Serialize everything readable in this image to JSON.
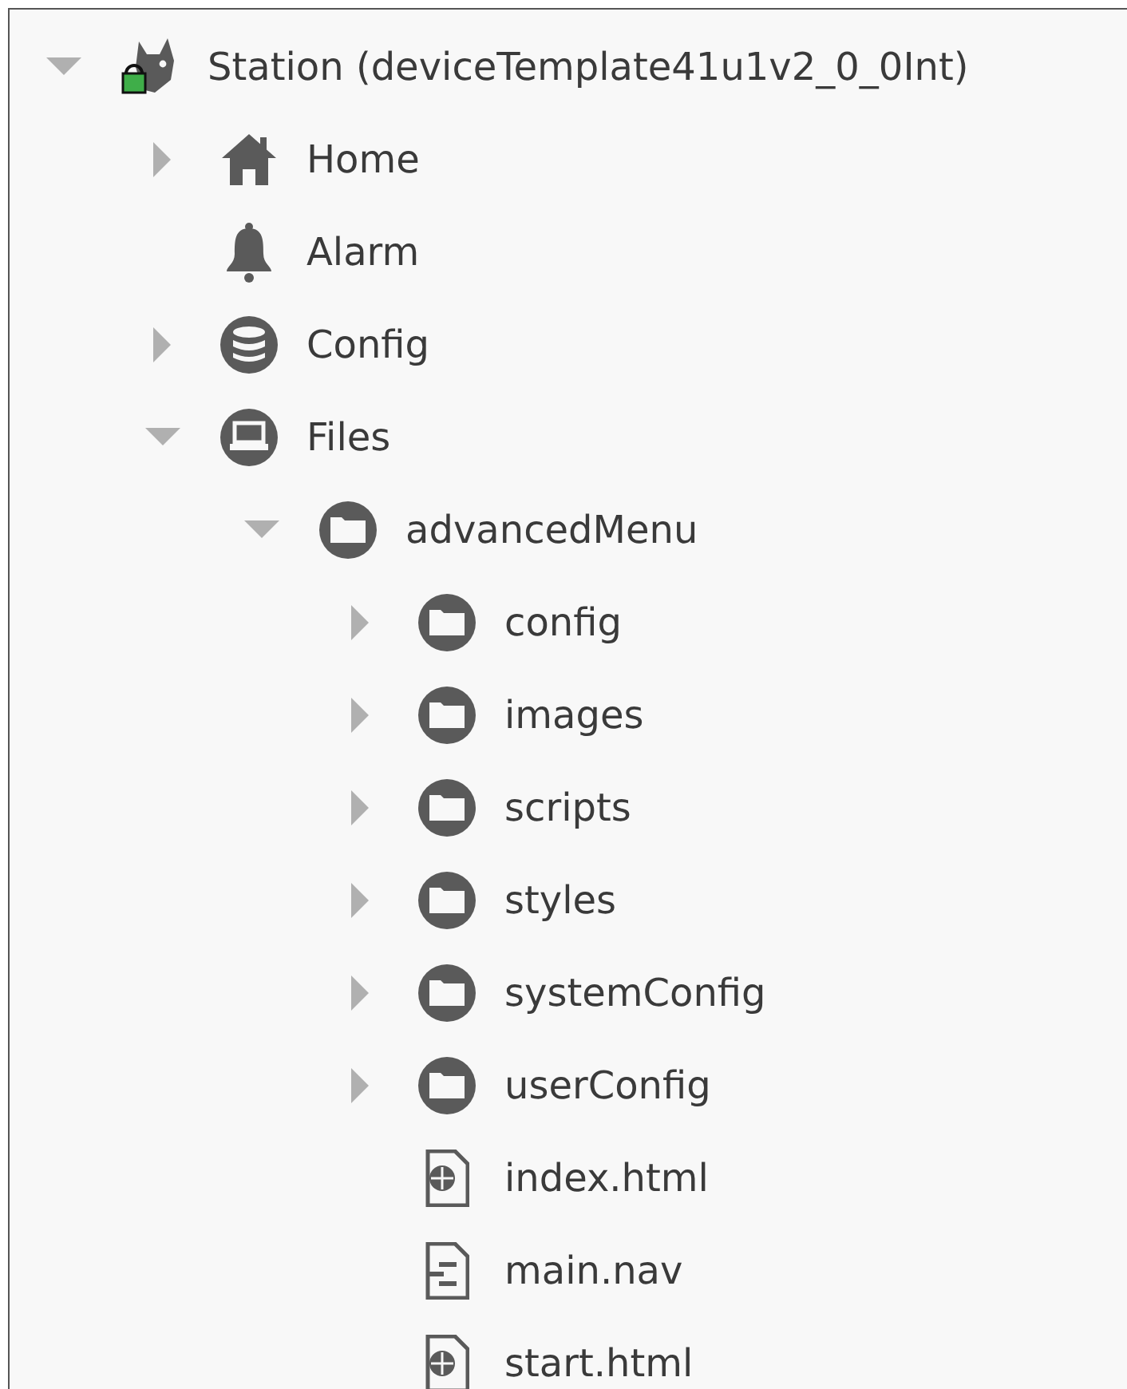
{
  "tree": [
    {
      "label": "Station (deviceTemplate41u1v2_0_0Int)",
      "kind": "station",
      "expanded": true,
      "children": [
        {
          "label": "Home",
          "kind": "home",
          "expanded": false
        },
        {
          "label": "Alarm",
          "kind": "alarm"
        },
        {
          "label": "Config",
          "kind": "database",
          "expanded": false
        },
        {
          "label": "Files",
          "kind": "files",
          "expanded": true,
          "children": [
            {
              "label": "advancedMenu",
              "kind": "folder",
              "expanded": true,
              "children": [
                {
                  "label": "config",
                  "kind": "folder",
                  "expanded": false
                },
                {
                  "label": "images",
                  "kind": "folder",
                  "expanded": false
                },
                {
                  "label": "scripts",
                  "kind": "folder",
                  "expanded": false
                },
                {
                  "label": "styles",
                  "kind": "folder",
                  "expanded": false
                },
                {
                  "label": "systemConfig",
                  "kind": "folder",
                  "expanded": false
                },
                {
                  "label": "userConfig",
                  "kind": "folder",
                  "expanded": false
                },
                {
                  "label": "index.html",
                  "kind": "html"
                },
                {
                  "label": "main.nav",
                  "kind": "nav"
                },
                {
                  "label": "start.html",
                  "kind": "html"
                }
              ]
            }
          ]
        }
      ]
    }
  ]
}
